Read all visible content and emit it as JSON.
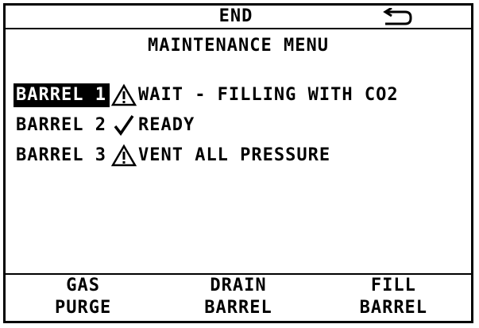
{
  "topbar": {
    "end_label": "END",
    "back_icon": "back-arrow-icon"
  },
  "title": "MAINTENANCE MENU",
  "barrels": [
    {
      "label": "BARREL 1",
      "status_icon": "warning-icon",
      "status_text": "WAIT - FILLING WITH CO2",
      "selected": true
    },
    {
      "label": "BARREL 2",
      "status_icon": "checkmark-icon",
      "status_text": "READY",
      "selected": false
    },
    {
      "label": "BARREL 3",
      "status_icon": "warning-icon",
      "status_text": "VENT ALL PRESSURE",
      "selected": false
    }
  ],
  "softkeys": [
    {
      "line1": "GAS",
      "line2": "PURGE"
    },
    {
      "line1": "DRAIN",
      "line2": "BARREL"
    },
    {
      "line1": "FILL",
      "line2": "BARREL"
    }
  ]
}
